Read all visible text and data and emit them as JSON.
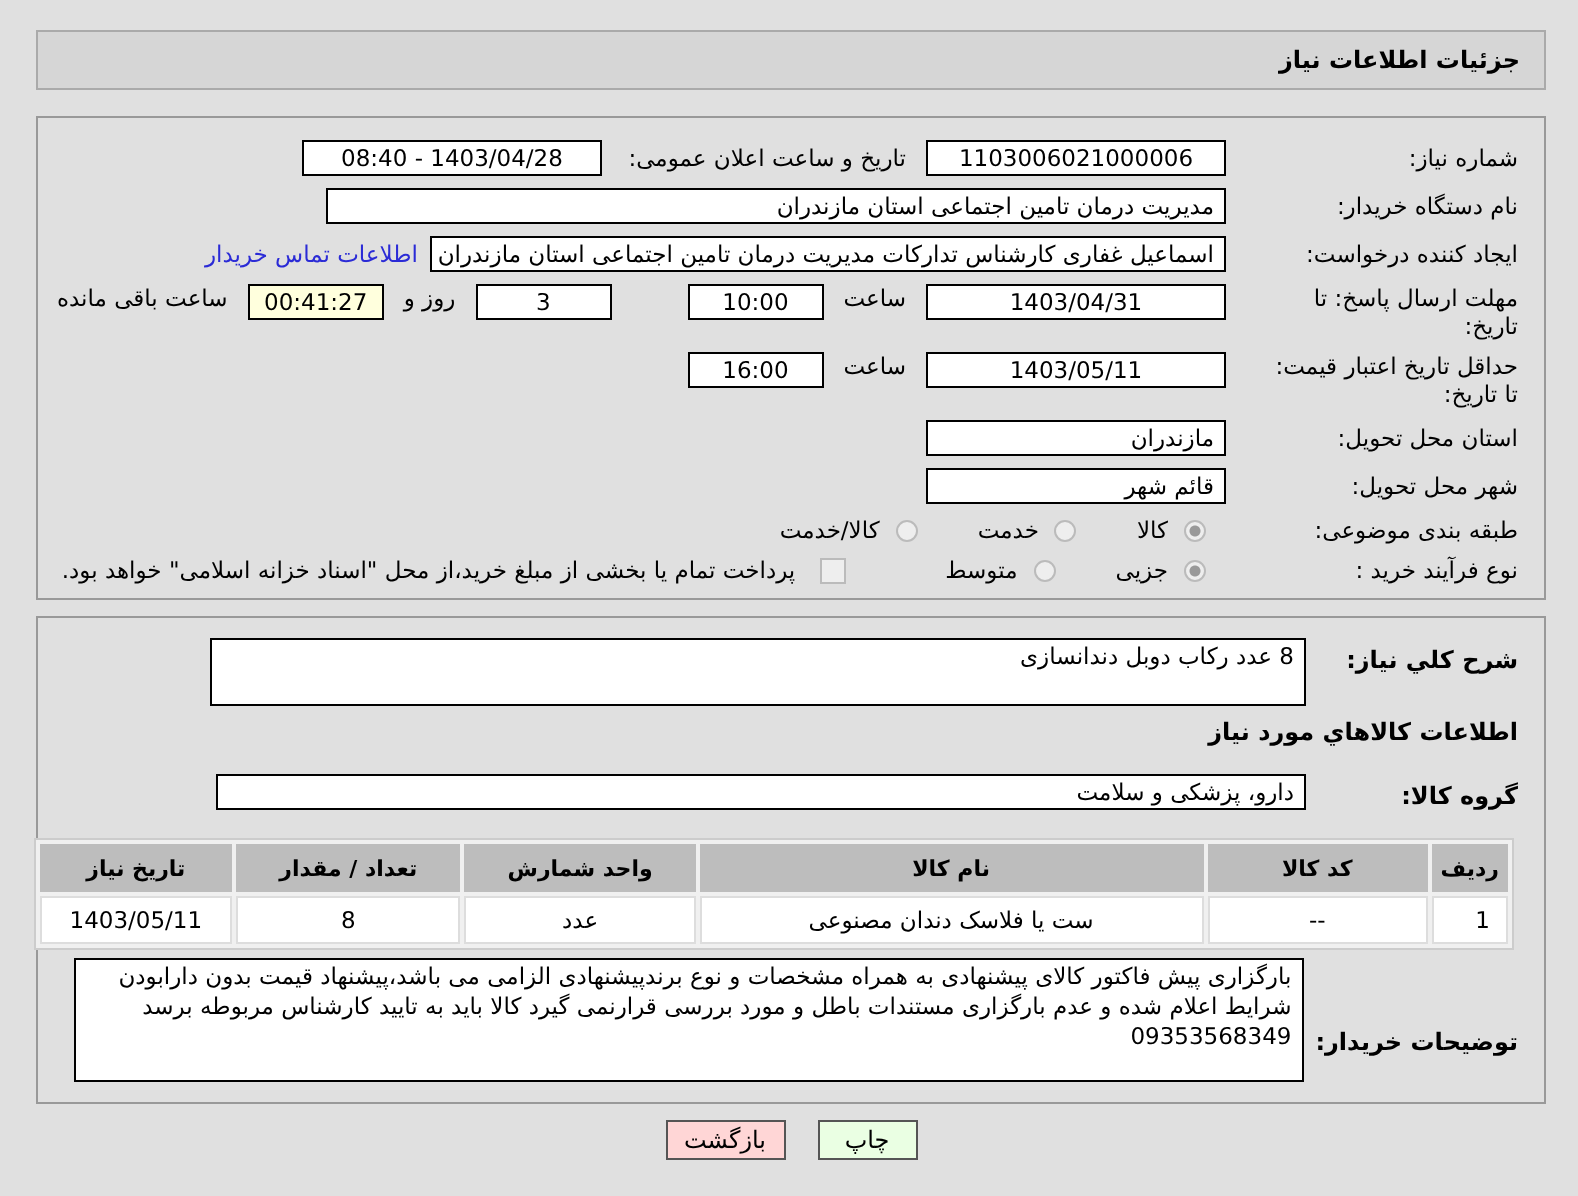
{
  "header": {
    "title": "جزئیات اطلاعات نیاز"
  },
  "need_number": {
    "label": "شماره نیاز:",
    "value": "1103006021000006"
  },
  "announce": {
    "label": "تاریخ و ساعت اعلان عمومی:",
    "value": "1403/04/28 - 08:40"
  },
  "buyer_org": {
    "label": "نام دستگاه خریدار:",
    "value": "مدیریت درمان تامین اجتماعی استان مازندران"
  },
  "requester": {
    "label": "ایجاد کننده درخواست:",
    "value": "اسماعیل غفاری کارشناس تدارکات مدیریت درمان تامین اجتماعی استان مازندران",
    "link": "اطلاعات تماس خریدار"
  },
  "deadline": {
    "label": "مهلت ارسال پاسخ: تا تاریخ:",
    "date": "1403/04/31",
    "time_label": "ساعت",
    "time": "10:00",
    "days": "3",
    "days_label": "روز و",
    "remaining": "00:41:27",
    "remaining_label": "ساعت باقی مانده"
  },
  "validity": {
    "label": "حداقل تاریخ اعتبار قیمت: تا تاریخ:",
    "date": "1403/05/11",
    "time_label": "ساعت",
    "time": "16:00"
  },
  "province": {
    "label": "استان محل تحویل:",
    "value": "مازندران"
  },
  "city": {
    "label": "شهر محل تحویل:",
    "value": "قائم شهر"
  },
  "category": {
    "label": "طبقه بندی موضوعی:",
    "options": [
      {
        "label": "کالا",
        "selected": true
      },
      {
        "label": "خدمت",
        "selected": false
      },
      {
        "label": "کالا/خدمت",
        "selected": false
      }
    ]
  },
  "process": {
    "label": "نوع فرآیند خرید :",
    "options": [
      {
        "label": "جزیی",
        "selected": true
      },
      {
        "label": "متوسط",
        "selected": false
      }
    ],
    "payment": {
      "label": "پرداخت تمام یا بخشی از مبلغ خرید،از محل \"اسناد خزانه اسلامی\" خواهد بود.",
      "checked": false
    }
  },
  "description": {
    "label": "شرح کلي نياز:",
    "value": "8 عدد رکاب دوبل دندانسازی"
  },
  "goods_heading": "اطلاعات کالاهاي مورد نياز",
  "goods_group": {
    "label": "گروه کالا:",
    "value": "دارو، پزشکی و سلامت"
  },
  "table": {
    "columns": [
      "ردیف",
      "کد کالا",
      "نام کالا",
      "واحد شمارش",
      "تعداد / مقدار",
      "تاریخ نیاز"
    ],
    "rows": [
      [
        "1",
        "--",
        "ست یا فلاسک دندان مصنوعی",
        "عدد",
        "8",
        "1403/05/11"
      ]
    ]
  },
  "buyer_notes": {
    "label": "توضیحات خریدار:",
    "value": "بارگزاری پیش فاکتور کالای پیشنهادی به همراه مشخصات و نوع برندپیشنهادی الزامی می باشد،پیشنهاد قیمت بدون دارابودن شرایط اعلام شده و عدم بارگزاری مستندات باطل و مورد بررسی قرارنمی گیرد کالا باید به تایید کارشناس مربوطه برسد 09353568349"
  },
  "buttons": [
    {
      "kind": "print",
      "label": "چاپ"
    },
    {
      "kind": "back",
      "label": "بازگشت"
    }
  ]
}
